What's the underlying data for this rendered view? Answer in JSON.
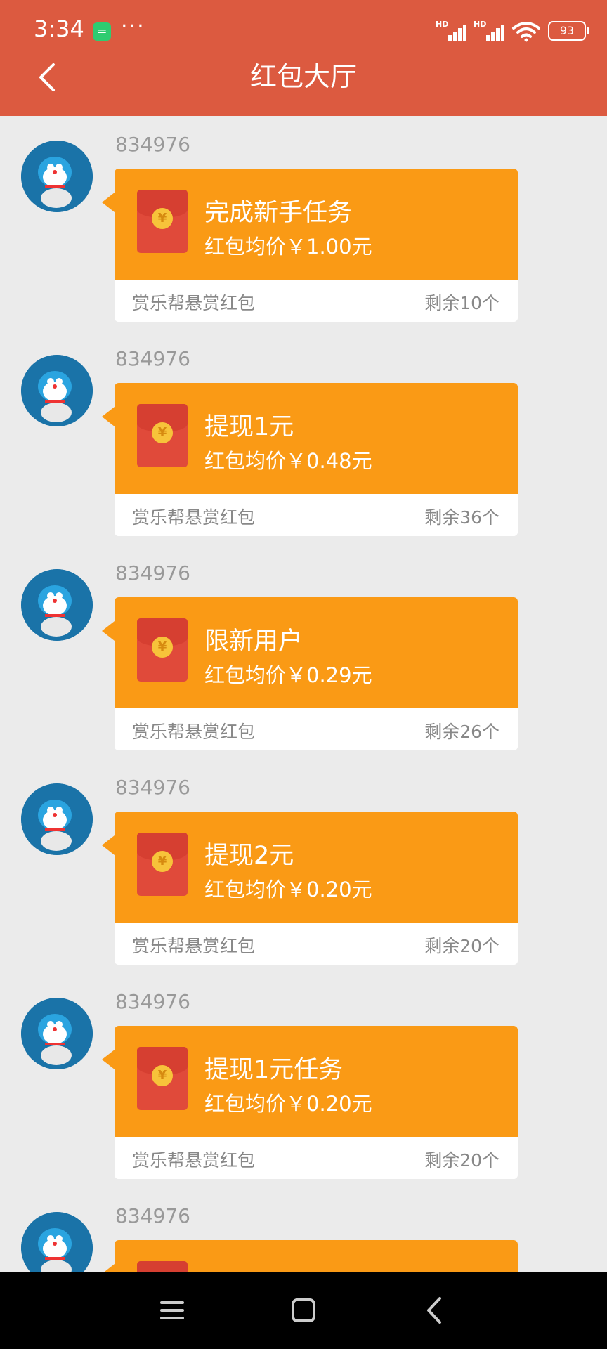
{
  "status_bar": {
    "time": "3:34",
    "battery": "93",
    "network_1": "HD",
    "network_2": "HD"
  },
  "header": {
    "title": "红包大厅"
  },
  "items": [
    {
      "sender": "834976",
      "title": "完成新手任务",
      "price": "红包均价￥1.00元",
      "source": "赏乐帮悬赏红包",
      "remaining": "剩余10个"
    },
    {
      "sender": "834976",
      "title": "提现1元",
      "price": "红包均价￥0.48元",
      "source": "赏乐帮悬赏红包",
      "remaining": "剩余36个"
    },
    {
      "sender": "834976",
      "title": "限新用户",
      "price": "红包均价￥0.29元",
      "source": "赏乐帮悬赏红包",
      "remaining": "剩余26个"
    },
    {
      "sender": "834976",
      "title": "提现2元",
      "price": "红包均价￥0.20元",
      "source": "赏乐帮悬赏红包",
      "remaining": "剩余20个"
    },
    {
      "sender": "834976",
      "title": "提现1元任务",
      "price": "红包均价￥0.20元",
      "source": "赏乐帮悬赏红包",
      "remaining": "剩余20个"
    },
    {
      "sender": "834976",
      "title": "",
      "price": "",
      "source": "",
      "remaining": ""
    }
  ],
  "icons": {
    "back": "chevron-left-icon",
    "envelope": "red-envelope-icon",
    "nav_menu": "menu-icon",
    "nav_home": "home-square-icon",
    "nav_back": "back-chevron-icon"
  },
  "colors": {
    "header": "#dc5a40",
    "card": "#fa9a15",
    "envelope": "#e04a3a",
    "background": "#ebebeb"
  }
}
